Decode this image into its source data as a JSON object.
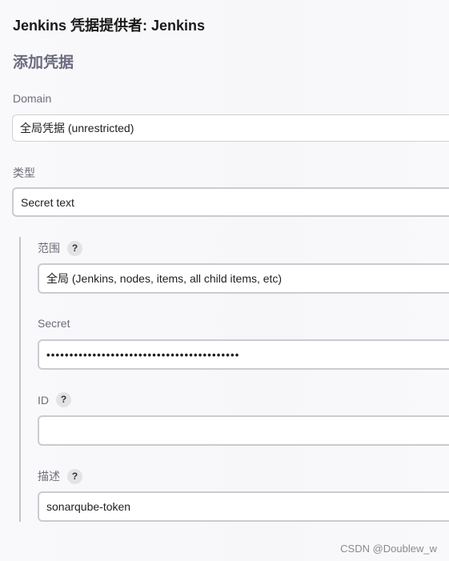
{
  "header": {
    "title": "Jenkins 凭据提供者: Jenkins",
    "section": "添加凭据"
  },
  "form": {
    "domain": {
      "label": "Domain",
      "value": "全局凭据 (unrestricted)"
    },
    "kind": {
      "label": "类型",
      "value": "Secret text"
    },
    "scope": {
      "label": "范围",
      "value": "全局 (Jenkins, nodes, items, all child items, etc)",
      "help": "?"
    },
    "secret": {
      "label": "Secret",
      "value": "••••••••••••••••••••••••••••••••••••••••••"
    },
    "id": {
      "label": "ID",
      "value": "",
      "help": "?"
    },
    "description": {
      "label": "描述",
      "value": "sonarqube-token",
      "help": "?"
    }
  },
  "watermark": "CSDN @Doublew_w",
  "colors": {
    "title": "#1a1a1a",
    "section_title": "#6b6b80",
    "label": "#6e6e7a",
    "field_border": "#c9ccce",
    "help_bg": "#e3e3e6"
  }
}
